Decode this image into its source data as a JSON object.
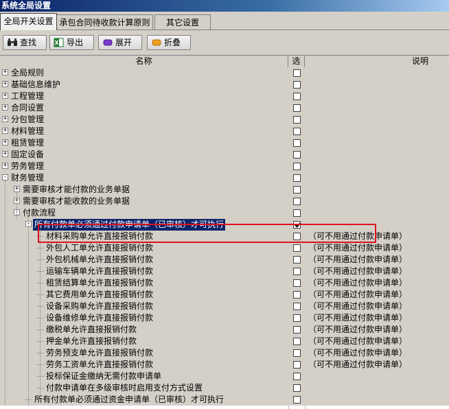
{
  "window": {
    "title": "系统全局设置"
  },
  "tabs": [
    {
      "label": "全局开关设置",
      "active": true
    },
    {
      "label": "承包合同待收款计算原则",
      "active": false
    },
    {
      "label": "其它设置",
      "active": false
    }
  ],
  "toolbar": {
    "find_label": "查找",
    "export_label": "导出",
    "expand_label": "展开",
    "collapse_label": "折叠"
  },
  "columns": {
    "name": "名称",
    "select": "选",
    "desc": "说明"
  },
  "rows": [
    {
      "label": "全局规则",
      "level": 0,
      "expander": "+",
      "checked": false,
      "desc": ""
    },
    {
      "label": "基础信息维护",
      "level": 0,
      "expander": "+",
      "checked": false,
      "desc": ""
    },
    {
      "label": "工程管理",
      "level": 0,
      "expander": "+",
      "checked": false,
      "desc": ""
    },
    {
      "label": "合同设置",
      "level": 0,
      "expander": "+",
      "checked": false,
      "desc": ""
    },
    {
      "label": "分包管理",
      "level": 0,
      "expander": "+",
      "checked": false,
      "desc": ""
    },
    {
      "label": "材料管理",
      "level": 0,
      "expander": "+",
      "checked": false,
      "desc": ""
    },
    {
      "label": "租赁管理",
      "level": 0,
      "expander": "+",
      "checked": false,
      "desc": ""
    },
    {
      "label": "固定设备",
      "level": 0,
      "expander": "+",
      "checked": false,
      "desc": ""
    },
    {
      "label": "劳务管理",
      "level": 0,
      "expander": "+",
      "checked": false,
      "desc": ""
    },
    {
      "label": "财务管理",
      "level": 0,
      "expander": "-",
      "checked": false,
      "desc": ""
    },
    {
      "label": "需要审核才能付款的业务单据",
      "level": 1,
      "expander": "+",
      "checked": false,
      "desc": ""
    },
    {
      "label": "需要审核才能收款的业务单据",
      "level": 1,
      "expander": "+",
      "checked": false,
      "desc": ""
    },
    {
      "label": "付款流程",
      "level": 1,
      "expander": "-",
      "checked": false,
      "desc": ""
    },
    {
      "label": "所有付款单必须通过付款申请单（已审核）才可执行",
      "level": 2,
      "expander": "-",
      "checked": true,
      "selected": true,
      "desc": ""
    },
    {
      "label": "材料采购单允许直接报销付款",
      "level": 3,
      "expander": "",
      "checked": false,
      "desc": "（可不用通过付款申请单）"
    },
    {
      "label": "外包人工单允许直接报销付款",
      "level": 3,
      "expander": "",
      "checked": false,
      "desc": "（可不用通过付款申请单）"
    },
    {
      "label": "外包机械单允许直接报销付款",
      "level": 3,
      "expander": "",
      "checked": false,
      "desc": "（可不用通过付款申请单）"
    },
    {
      "label": "运输车辆单允许直接报销付款",
      "level": 3,
      "expander": "",
      "checked": false,
      "desc": "（可不用通过付款申请单）"
    },
    {
      "label": "租赁结算单允许直接报销付款",
      "level": 3,
      "expander": "",
      "checked": false,
      "desc": "（可不用通过付款申请单）"
    },
    {
      "label": "其它费用单允许直接报销付款",
      "level": 3,
      "expander": "",
      "checked": false,
      "desc": "（可不用通过付款申请单）"
    },
    {
      "label": "设备采购单允许直接报销付款",
      "level": 3,
      "expander": "",
      "checked": false,
      "desc": "（可不用通过付款申请单）"
    },
    {
      "label": "设备维修单允许直接报销付款",
      "level": 3,
      "expander": "",
      "checked": false,
      "desc": "（可不用通过付款申请单）"
    },
    {
      "label": "缴税单允许直接报销付款",
      "level": 3,
      "expander": "",
      "checked": false,
      "desc": "（可不用通过付款申请单）"
    },
    {
      "label": "押金单允许直接报销付款",
      "level": 3,
      "expander": "",
      "checked": false,
      "desc": "（可不用通过付款申请单）"
    },
    {
      "label": "劳务预支单允许直接报销付款",
      "level": 3,
      "expander": "",
      "checked": false,
      "desc": "（可不用通过付款申请单）"
    },
    {
      "label": "劳务工资单允许直接报销付款",
      "level": 3,
      "expander": "",
      "checked": false,
      "desc": "（可不用通过付款申请单）"
    },
    {
      "label": "投标保证金缴纳无需付款申请单",
      "level": 3,
      "expander": "",
      "checked": false,
      "desc": ""
    },
    {
      "label": "付款申请单在多级审核时启用支付方式设置",
      "level": 3,
      "expander": "",
      "checked": false,
      "desc": ""
    },
    {
      "label": "所有付款单必须通过资金申请单（已审核）才可执行",
      "level": 2,
      "expander": "",
      "checked": false,
      "desc": ""
    }
  ],
  "colors": {
    "title_bar": "#0a246a",
    "selection": "#0a246a",
    "highlight_box": "#e0101c"
  }
}
